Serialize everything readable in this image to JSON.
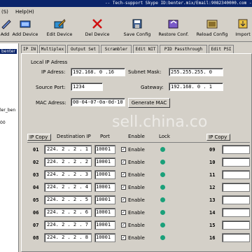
{
  "title_bar": "-- Tech-support Skype ID:benter.mix/Email:9082340000.com ---",
  "menu": [
    "(S)",
    "Help(H)"
  ],
  "toolbar": [
    {
      "label": "Add",
      "icon": "pencil-icon"
    },
    {
      "label": "Add Device",
      "icon": "add-device-icon"
    },
    {
      "label": "Edit Device",
      "icon": "edit-device-icon"
    },
    {
      "label": "Del Device",
      "icon": "delete-icon"
    },
    {
      "label": "Save Config",
      "icon": "save-icon"
    },
    {
      "label": "Restore Conf.",
      "icon": "restore-icon"
    },
    {
      "label": "Reload Config",
      "icon": "reload-icon"
    },
    {
      "label": "Import",
      "icon": "import-icon"
    }
  ],
  "tree": {
    "selected": "benter",
    "item2": "ler_ben",
    "item3": "00"
  },
  "tabs": [
    "IP IN",
    "Multiplex",
    "Output Set",
    "Scrambler",
    "Edit NIT",
    "PID Passthrough",
    "Edit PSI"
  ],
  "local_ip": {
    "group_title": "Local IP Adress",
    "ip_label": "IP Adress:",
    "ip_value": "192.168. 0 .16",
    "mask_label": "Subnet Mask:",
    "mask_value": "255.255.255. 0",
    "port_label": "Source Port:",
    "port_value": "1234",
    "gateway_label": "Gateway:",
    "gateway_value": "192.168. 0 . 1",
    "mac_label": "MAC Adress:",
    "mac_value": "00-04-07-0a-0d-10",
    "generate_mac": "Generate MAC"
  },
  "table_headers": {
    "ip_copy": "IP Copy",
    "dest": "Destination IP",
    "port": "Port",
    "enable": "Enable",
    "lock": "Lock",
    "ip_copy_right": "IP Copy"
  },
  "enable_label": "Enable",
  "rows": [
    {
      "num": "01",
      "ip": "224. 2 . 2 . 1",
      "port": "10001",
      "enabled": "✓"
    },
    {
      "num": "02",
      "ip": "224. 2 . 2 . 2",
      "port": "10001",
      "enabled": "✓"
    },
    {
      "num": "03",
      "ip": "224. 2 . 2 . 3",
      "port": "10001",
      "enabled": "✓"
    },
    {
      "num": "04",
      "ip": "224. 2 . 2 . 4",
      "port": "10001",
      "enabled": "✓"
    },
    {
      "num": "05",
      "ip": "224. 2 . 2 . 5",
      "port": "10001",
      "enabled": "✓"
    },
    {
      "num": "06",
      "ip": "224. 2 . 2 . 6",
      "port": "10001",
      "enabled": "✓"
    },
    {
      "num": "07",
      "ip": "224. 2 . 2 . 7",
      "port": "10001",
      "enabled": "✓"
    },
    {
      "num": "08",
      "ip": "224. 2 . 2 . 8",
      "port": "10001",
      "enabled": "✓"
    }
  ],
  "right_rows": [
    "09",
    "10",
    "11",
    "12",
    "13",
    "14",
    "15",
    "16"
  ],
  "watermark": "sell.china.co"
}
